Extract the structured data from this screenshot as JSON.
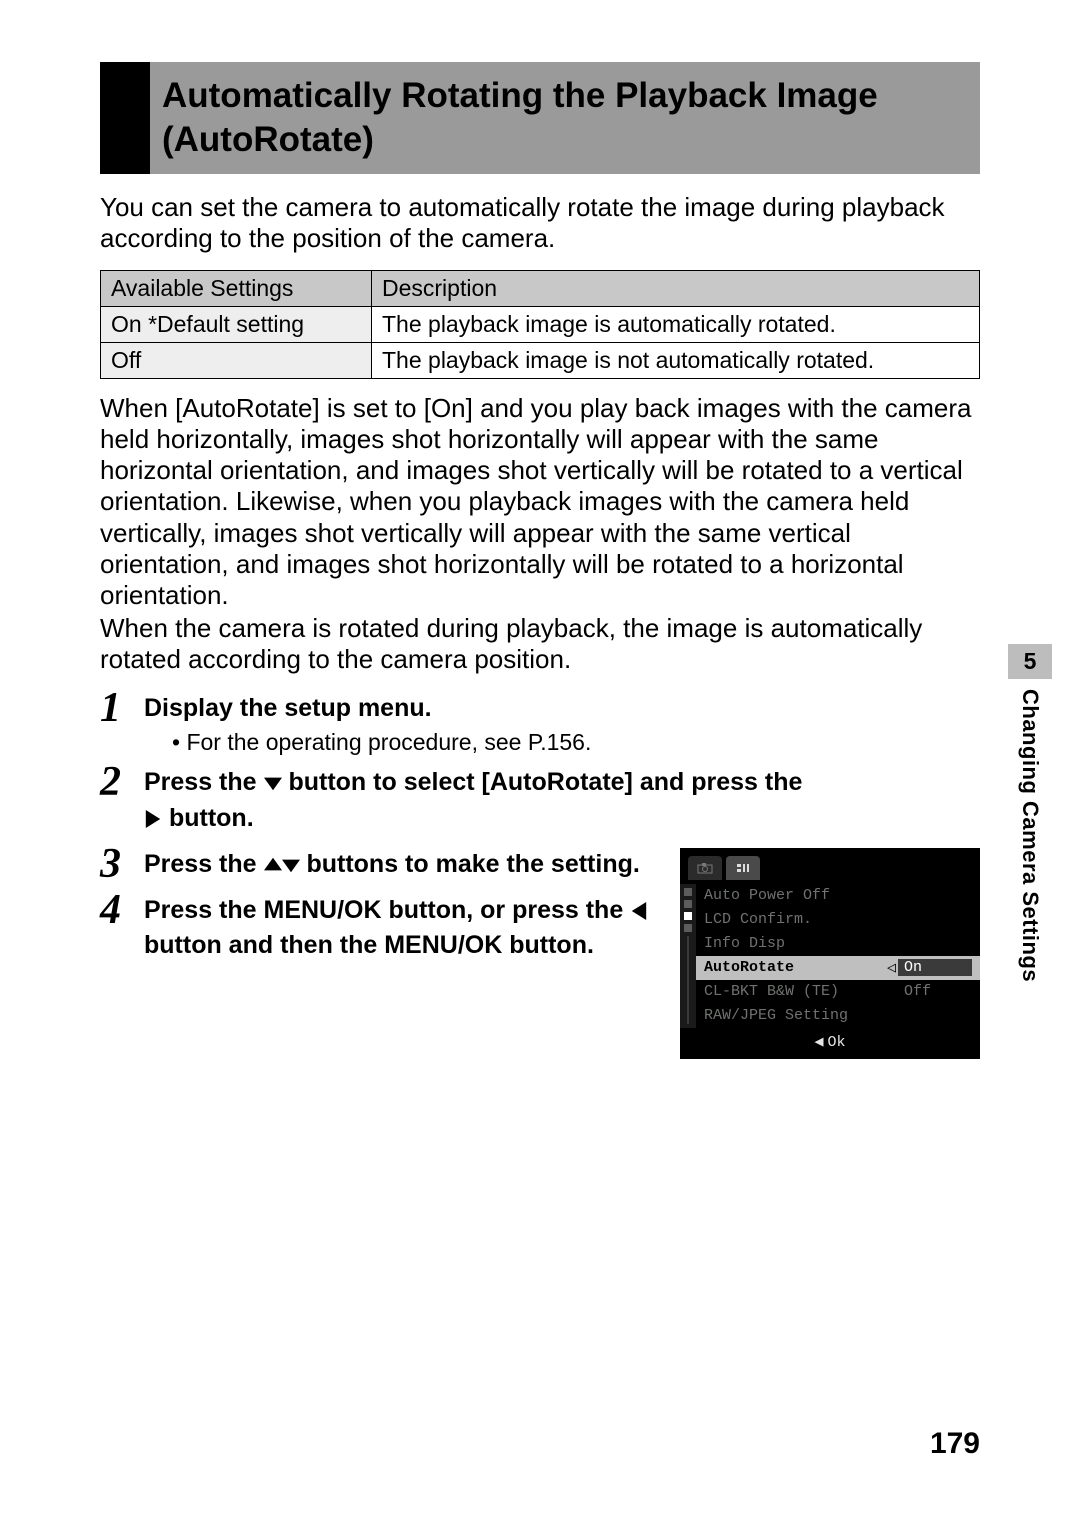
{
  "title": "Automatically Rotating the Playback Image (AutoRotate)",
  "intro": "You can set the camera to automatically rotate the image during playback according to the position of the camera.",
  "table": {
    "head": {
      "col1": "Available Settings",
      "col2": "Description"
    },
    "rows": [
      {
        "col1": "On *Default setting",
        "col2": "The playback image is automatically rotated."
      },
      {
        "col1": "Off",
        "col2": "The playback image is not automatically rotated."
      }
    ]
  },
  "explain1": "When [AutoRotate] is set to [On] and you play back images with the camera held horizontally, images shot horizontally will appear with the same horizontal orientation, and images shot vertically will be rotated to a vertical orientation. Likewise, when you playback images with the camera held vertically, images shot vertically will appear with the same vertical orientation, and images shot horizontally will be rotated to a horizontal orientation.",
  "explain2": "When the camera is rotated during playback, the image is automatically rotated according to the camera position.",
  "steps": {
    "s1": {
      "num": "1",
      "head": "Display the setup menu.",
      "sub": "For the operating procedure, see P.156."
    },
    "s2": {
      "num": "2",
      "head_a": "Press the ",
      "head_b": " button to select [AutoRotate] and press the ",
      "head_c": " button."
    },
    "s3": {
      "num": "3",
      "head_a": "Press the ",
      "head_b": " buttons to make the setting."
    },
    "s4": {
      "num": "4",
      "head_a": "Press the MENU/OK button, or press the ",
      "head_b": " button and then the MENU/OK button."
    }
  },
  "lcd": {
    "rows": [
      {
        "label": "Auto Power Off",
        "val": ""
      },
      {
        "label": "LCD Confirm.",
        "val": ""
      },
      {
        "label": "Info Disp",
        "val": ""
      },
      {
        "label": "AutoRotate",
        "val": "On",
        "selected": true
      },
      {
        "label": "CL-BKT B&W (TE)",
        "val": "Off"
      },
      {
        "label": "RAW/JPEG Setting",
        "val": ""
      }
    ],
    "footer": "Ok"
  },
  "sidetab": {
    "chapter": "5",
    "label": "Changing Camera Settings"
  },
  "page_number": "179"
}
